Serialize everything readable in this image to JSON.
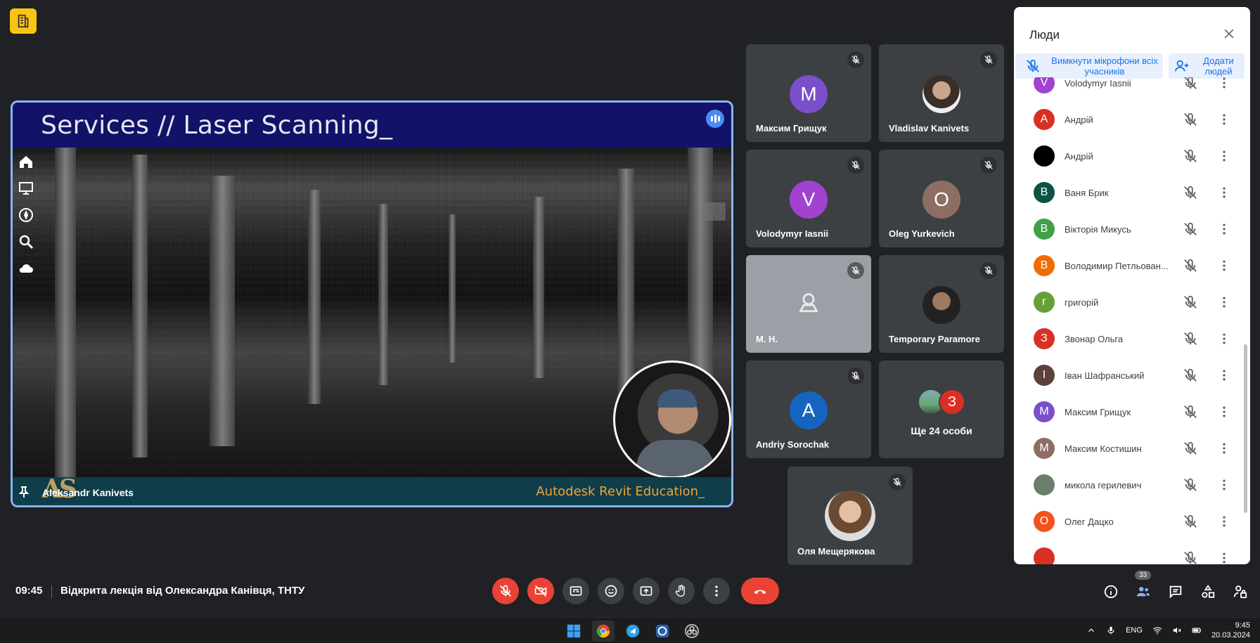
{
  "presentation": {
    "slide_title": "Services // Laser Scanning_",
    "presenter_name": "Aleksandr Kanivets",
    "footer_brand": "Autodesk Revit Education_"
  },
  "tiles": [
    {
      "name": "Максим Грищук",
      "initial": "M",
      "color": "#7b4fc9"
    },
    {
      "name": "Vladislav Kanivets",
      "initial": "",
      "color": "#caa58a"
    },
    {
      "name": "Volodymyr Iasnii",
      "initial": "V",
      "color": "#a142d1"
    },
    {
      "name": "Oleg Yurkevich",
      "initial": "O",
      "color": "#8d6e63"
    },
    {
      "name": "М. Н.",
      "initial": "",
      "color": "#9aa0a6"
    },
    {
      "name": "Temporary Paramore",
      "initial": "",
      "color": "#444"
    },
    {
      "name": "Andriy Sorochak",
      "initial": "A",
      "color": "#1565c0"
    },
    {
      "name": "Ще 24 особи",
      "initial": "З",
      "color": "#d93025"
    },
    {
      "name": "Оля Мещерякова",
      "initial": "",
      "color": "#777"
    }
  ],
  "panel": {
    "title": "Люди",
    "mute_all_label": "Вимкнути мікрофони всіх учасників",
    "add_people_label": "Додати людей",
    "participants": [
      {
        "name": "Volodymyr Iasnii",
        "initial": "V",
        "color": "#a142d1"
      },
      {
        "name": "Андрій",
        "initial": "A",
        "color": "#d93025"
      },
      {
        "name": "Андрій",
        "initial": "",
        "color": "#000000"
      },
      {
        "name": "Ваня Брик",
        "initial": "В",
        "color": "#0b5345"
      },
      {
        "name": "Вікторія Микусь",
        "initial": "В",
        "color": "#43a047"
      },
      {
        "name": "Володимир Петльован...",
        "initial": "В",
        "color": "#ef6c00"
      },
      {
        "name": "григорій",
        "initial": "г",
        "color": "#689f38"
      },
      {
        "name": "Звонар Ольга",
        "initial": "З",
        "color": "#d93025"
      },
      {
        "name": "Іван Шафранський",
        "initial": "І",
        "color": "#5d4037"
      },
      {
        "name": "Максим Грищук",
        "initial": "M",
        "color": "#7b4fc9"
      },
      {
        "name": "Максим Костишин",
        "initial": "M",
        "color": "#8d6e63"
      },
      {
        "name": "микола герилевич",
        "initial": "",
        "color": "#6a7f6a"
      },
      {
        "name": "Олег Дацко",
        "initial": "О",
        "color": "#f4511e"
      },
      {
        "name": "",
        "initial": "",
        "color": "#d93025"
      }
    ]
  },
  "bottom": {
    "time": "09:45",
    "meeting_title": "Відкрита лекція від Олександра Канівця, ТНТУ",
    "people_count": "33"
  },
  "taskbar": {
    "lang": "ENG",
    "time": "9:45",
    "date": "20.03.2024"
  }
}
